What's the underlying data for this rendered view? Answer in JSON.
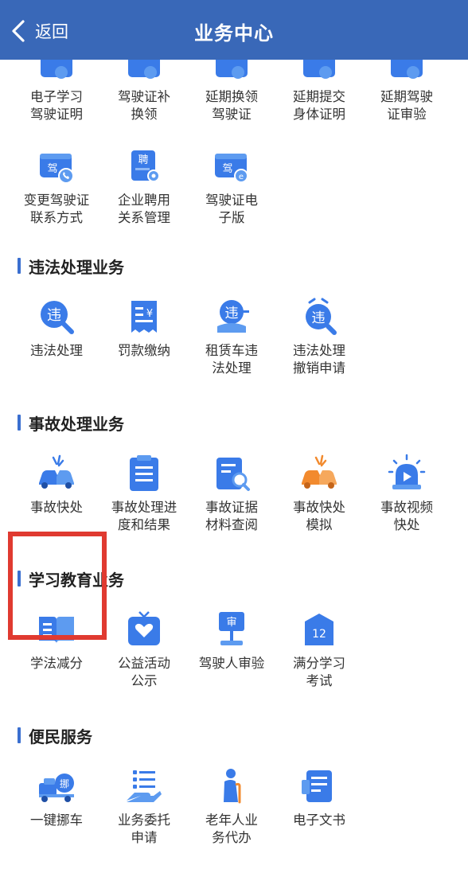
{
  "header": {
    "back_label": "返回",
    "title": "业务中心"
  },
  "license_row1": [
    {
      "label": "电子学习\n驾驶证明",
      "icon": "e-license-icon"
    },
    {
      "label": "驾驶证补\n换领",
      "icon": "license-replace-icon"
    },
    {
      "label": "延期换领\n驾驶证",
      "icon": "license-delay-icon"
    },
    {
      "label": "延期提交\n身体证明",
      "icon": "health-delay-icon"
    },
    {
      "label": "延期驾驶\n证审验",
      "icon": "audit-delay-icon"
    }
  ],
  "license_row2": [
    {
      "label": "变更驾驶证\n联系方式",
      "icon": "license-contact-icon",
      "badge": "驾"
    },
    {
      "label": "企业聘用\n关系管理",
      "icon": "employment-icon",
      "badge": "聘"
    },
    {
      "label": "驾驶证电\n子版",
      "icon": "e-license-card-icon",
      "badge": "驾"
    }
  ],
  "violation": {
    "title": "违法处理业务",
    "items": [
      {
        "label": "违法处理",
        "icon": "violation-search-icon",
        "badge": "违"
      },
      {
        "label": "罚款缴纳",
        "icon": "fine-receipt-icon",
        "badge": "¥"
      },
      {
        "label": "租赁车违\n法处理",
        "icon": "rental-violation-icon",
        "badge": "违"
      },
      {
        "label": "违法处理\n撤销申请",
        "icon": "violation-revoke-icon",
        "badge": "违"
      }
    ]
  },
  "accident": {
    "title": "事故处理业务",
    "items": [
      {
        "label": "事故快处",
        "icon": "car-crash-icon"
      },
      {
        "label": "事故处理进\n度和结果",
        "icon": "clipboard-icon"
      },
      {
        "label": "事故证据\n材料查阅",
        "icon": "document-search-icon"
      },
      {
        "label": "事故快处\n模拟",
        "icon": "car-crash-simulation-icon"
      },
      {
        "label": "事故视频\n快处",
        "icon": "siren-video-icon"
      }
    ]
  },
  "education": {
    "title": "学习教育业务",
    "items": [
      {
        "label": "学法减分",
        "icon": "open-book-icon"
      },
      {
        "label": "公益活动\n公示",
        "icon": "heart-hands-icon"
      },
      {
        "label": "驾驶人审验",
        "icon": "audit-board-icon",
        "badge": "审"
      },
      {
        "label": "满分学习\n考试",
        "icon": "calendar-12-icon",
        "badge": "12"
      }
    ]
  },
  "convenience": {
    "title": "便民服务",
    "items": [
      {
        "label": "一键挪车",
        "icon": "tow-truck-icon",
        "badge": "挪"
      },
      {
        "label": "业务委托\n申请",
        "icon": "hand-list-icon"
      },
      {
        "label": "老年人业\n务代办",
        "icon": "elderly-icon"
      },
      {
        "label": "电子文书",
        "icon": "e-document-icon"
      }
    ]
  },
  "colors": {
    "header": "#3968b8",
    "icon_blue": "#3a7be8",
    "icon_orange": "#f28a2e",
    "highlight": "#e03a30"
  }
}
